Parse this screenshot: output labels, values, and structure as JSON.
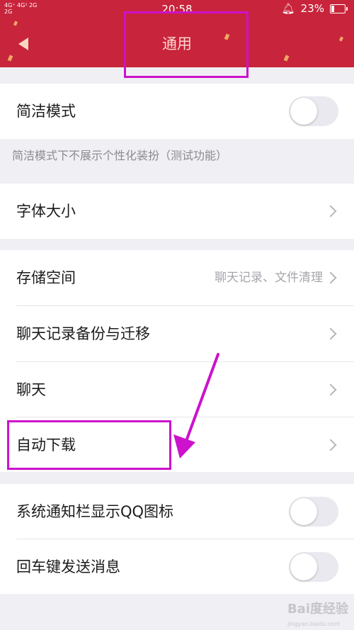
{
  "status_bar": {
    "network_top": "4G⁺ 4G¹  2G",
    "network_bottom": "  2G  ",
    "time": "20:58",
    "battery": "23%",
    "battery_level": 0.23
  },
  "header": {
    "title": "通用"
  },
  "settings": {
    "concise_mode": {
      "label": "简洁模式",
      "enabled": false
    },
    "concise_note": "简洁模式下不展示个性化装扮（测试功能）",
    "font_size": {
      "label": "字体大小"
    },
    "storage": {
      "label": "存储空间",
      "detail": "聊天记录、文件清理"
    },
    "backup": {
      "label": "聊天记录备份与迁移"
    },
    "chat": {
      "label": "聊天"
    },
    "auto_download": {
      "label": "自动下载"
    },
    "show_qq_icon": {
      "label": "系统通知栏显示QQ图标",
      "enabled": false
    },
    "enter_to_send": {
      "label": "回车键发送消息",
      "enabled": false
    }
  },
  "watermark": {
    "text": "Bai度经验",
    "sub": "jingyan.baidu.com"
  },
  "colors": {
    "header": "#c8243b",
    "annotation": "#cc12cc",
    "background": "#f0f0f4"
  }
}
